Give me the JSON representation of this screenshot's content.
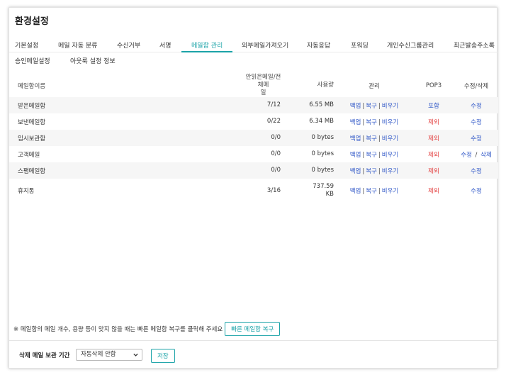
{
  "page": {
    "title": "환경설정"
  },
  "tabs": [
    "기본설정",
    "메일 자동 분류",
    "수신거부",
    "서명",
    "메일함 관리",
    "외부메일가져오기",
    "자동응답",
    "포워딩",
    "개인수신그룹관리",
    "최근발송주소록",
    "승인메일설정",
    "아웃룩 설정 정보"
  ],
  "active_tab": "메일함 관리",
  "table": {
    "headers": {
      "name": "메일함이름",
      "unread_line1": "안읽은메일/전체메",
      "unread_line2": "일",
      "size": "사용량",
      "manage": "관리",
      "pop3": "POP3",
      "edit": "수정/삭제"
    },
    "manage_labels": {
      "backup": "백업",
      "restore": "복구",
      "empty": "비우기",
      "separator": "|"
    },
    "rows": [
      {
        "name": "받은메일함",
        "unread": "7/12",
        "size": "6.55 MB",
        "size2": "",
        "pop3": "포함",
        "edit": "수정",
        "delete": ""
      },
      {
        "name": "보낸메일함",
        "unread": "0/22",
        "size": "6.34 MB",
        "size2": "",
        "pop3": "제외",
        "edit": "수정",
        "delete": ""
      },
      {
        "name": "임시보관함",
        "unread": "0/0",
        "size": "0 bytes",
        "size2": "",
        "pop3": "제외",
        "edit": "수정",
        "delete": ""
      },
      {
        "name": "고객메일",
        "unread": "0/0",
        "size": "0 bytes",
        "size2": "",
        "pop3": "제외",
        "edit": "수정",
        "delete": "삭제"
      },
      {
        "name": "스팸메일함",
        "unread": "0/0",
        "size": "0 bytes",
        "size2": "",
        "pop3": "제외",
        "edit": "수정",
        "delete": ""
      },
      {
        "name": "휴지통",
        "unread": "3/16",
        "size": "737.59",
        "size2": "KB",
        "pop3": "제외",
        "edit": "수정",
        "delete": ""
      }
    ]
  },
  "notice": {
    "text": "※ 메일함의 메일 개수, 용량 등이 맞지 않을 때는 빠른 메일함 복구를 클릭해 주세요",
    "button": "빠른 메일함 복구"
  },
  "retention": {
    "label": "삭제 메일 보관 기간",
    "selected": "자동삭제 안함",
    "save": "저장"
  },
  "colors": {
    "accent": "#1ba3a8",
    "link": "#2e56c7",
    "excluded": "#e23a3a"
  }
}
